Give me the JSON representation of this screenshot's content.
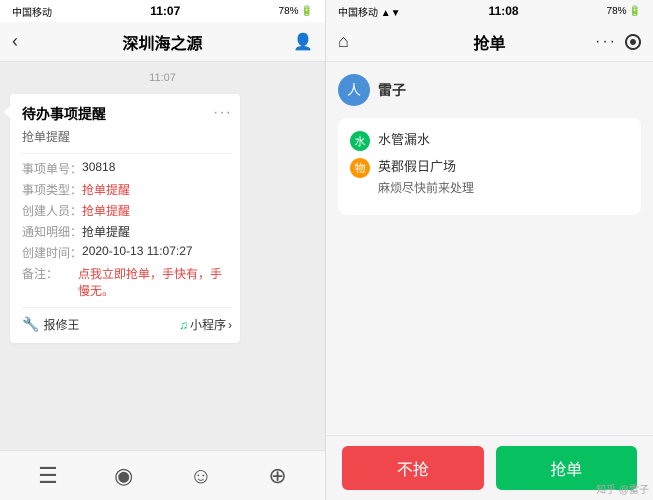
{
  "left_phone": {
    "status_bar": {
      "carrier": "中国移动",
      "wifi_icon": "wifi",
      "time": "11:07",
      "battery_icon": "battery",
      "battery_percent": "78%",
      "bluetooth_icon": "bluetooth"
    },
    "nav": {
      "back_icon": "‹",
      "title": "深圳海之源",
      "profile_icon": "person"
    },
    "chat_time": "11:07",
    "message": {
      "card_title": "待办事项提醒",
      "card_dots": "···",
      "card_subtitle": "抢单提醒",
      "fields": [
        {
          "label": "事项单号：",
          "value": "30818",
          "red": false
        },
        {
          "label": "事项类型：",
          "value": "抢单提醒",
          "red": true
        },
        {
          "label": "创建人员：",
          "value": "抢单提醒",
          "red": true
        },
        {
          "label": "通知明细：",
          "value": "抢单提醒",
          "red": false
        },
        {
          "label": "创建时间：",
          "value": "2020-10-13 11:07:27",
          "red": false
        },
        {
          "label": "备注：",
          "value": "点我立即抢单，手快有，手慢无。",
          "red": true
        }
      ],
      "footer_left": "报修王",
      "footer_mini_label": "小程序",
      "footer_arrow": "›"
    },
    "toolbar": {
      "voice_icon": "☰",
      "sound_icon": "◉",
      "emoji_icon": "☺",
      "add_icon": "⊕"
    }
  },
  "right_phone": {
    "status_bar": {
      "carrier": "中国移动",
      "wifi_icon": "wifi",
      "time": "11:08",
      "battery_icon": "battery",
      "battery_percent": "78%"
    },
    "nav": {
      "home_icon": "⌂",
      "title": "抢单",
      "dots_icon": "···",
      "record_icon": "record"
    },
    "user": {
      "avatar_text": "人",
      "name": "雷子"
    },
    "info": {
      "item1_icon": "水",
      "item1_text": "水管漏水",
      "item2_icon": "物",
      "item2_text": "英郡假日广场",
      "item3_text": "麻烦尽快前来处理"
    },
    "buttons": {
      "reject_label": "不抢",
      "accept_label": "抢单"
    }
  },
  "watermark": "知乎 @雷子"
}
